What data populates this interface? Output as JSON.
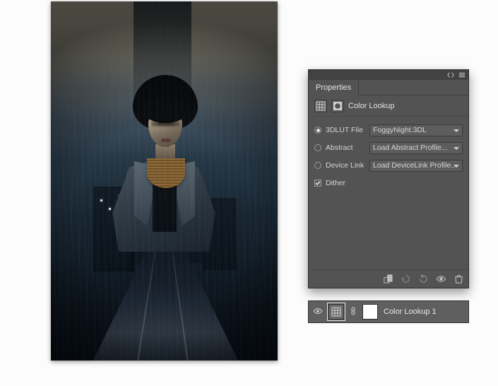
{
  "panel": {
    "tab_label": "Properties",
    "title": "Color Lookup",
    "options": {
      "lut": {
        "label": "3DLUT File",
        "value": "FoggyNight.3DL",
        "selected": true
      },
      "abstract": {
        "label": "Abstract",
        "value": "Load Abstract Profile...",
        "selected": false
      },
      "devicelink": {
        "label": "Device Link",
        "value": "Load DeviceLink Profile...",
        "selected": false
      }
    },
    "dither": {
      "label": "Dither",
      "checked": true
    }
  },
  "layer": {
    "name": "Color Lookup 1"
  }
}
